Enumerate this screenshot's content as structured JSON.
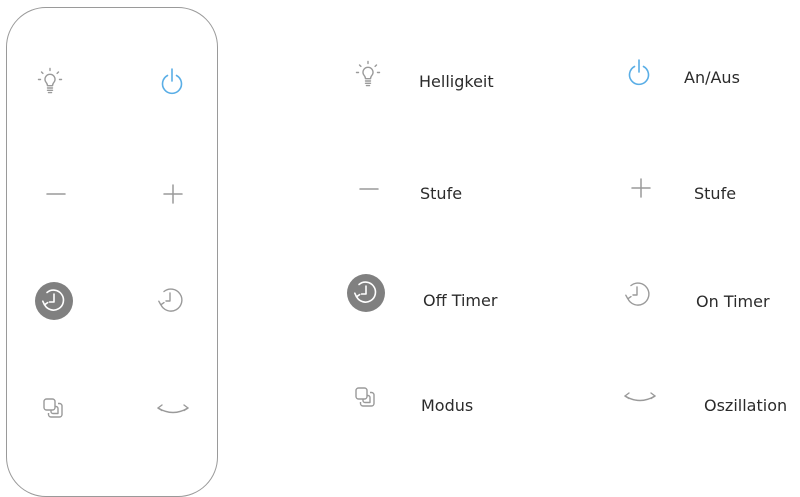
{
  "colors": {
    "icon_gray": "#9a9a9a",
    "power_blue": "#5aaee6",
    "timer_fill": "#808080",
    "text": "#2b2b2b"
  },
  "remote": {
    "buttons": [
      {
        "icon": "bulb-icon"
      },
      {
        "icon": "power-icon"
      },
      {
        "icon": "minus-icon"
      },
      {
        "icon": "plus-icon"
      },
      {
        "icon": "off-timer-icon"
      },
      {
        "icon": "on-timer-icon"
      },
      {
        "icon": "mode-icon"
      },
      {
        "icon": "oscillation-icon"
      }
    ]
  },
  "legend": {
    "items": [
      {
        "icon": "bulb-icon",
        "label": "Helligkeit"
      },
      {
        "icon": "power-icon",
        "label": "An/Aus"
      },
      {
        "icon": "minus-icon",
        "label": "Stufe"
      },
      {
        "icon": "plus-icon",
        "label": "Stufe"
      },
      {
        "icon": "off-timer-icon",
        "label": "Off Timer"
      },
      {
        "icon": "on-timer-icon",
        "label": "On Timer"
      },
      {
        "icon": "mode-icon",
        "label": "Modus"
      },
      {
        "icon": "oscillation-icon",
        "label": "Oszillation"
      }
    ]
  }
}
